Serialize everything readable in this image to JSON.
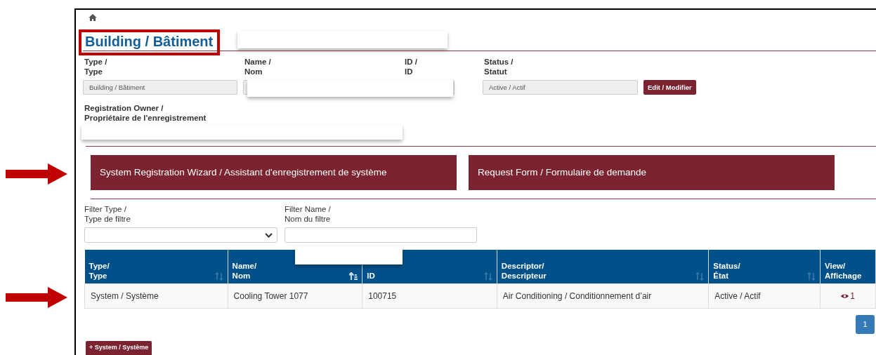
{
  "title": "Building / Bâtiment",
  "fields": [
    {
      "label_lines": [
        "Type /",
        "Type"
      ],
      "value": "Building / Bâtiment"
    },
    {
      "label_lines": [
        "Name /",
        "Nom"
      ]
    },
    {
      "label_lines": [
        "ID /",
        "ID"
      ]
    },
    {
      "label_lines": [
        "Status /",
        "Statut"
      ],
      "value": "Active / Actif"
    }
  ],
  "edit_button": "Edit / Modifier",
  "registration_owner": {
    "label_lines": [
      "Registration Owner /",
      "Propriétaire de l'enregistrement"
    ]
  },
  "action_buttons": [
    "System Registration Wizard / Assistant d'enregistrement de système",
    "Request Form / Formulaire de demande"
  ],
  "filters": [
    {
      "kind": "select",
      "label_lines": [
        "Filter Type /",
        "Type de filtre"
      ]
    },
    {
      "kind": "text",
      "label_lines": [
        "Filter Name /",
        "Nom du filtre"
      ]
    }
  ],
  "table": {
    "columns": [
      {
        "lines": [
          "Type/",
          "Type"
        ],
        "sortable": true,
        "sorted": false
      },
      {
        "lines": [
          "Name/",
          "Nom"
        ],
        "sortable": true,
        "sorted": true
      },
      {
        "lines": [
          "ID"
        ],
        "sortable": true,
        "sorted": false
      },
      {
        "lines": [
          "Descriptor/",
          "Descripteur"
        ],
        "sortable": true,
        "sorted": false
      },
      {
        "lines": [
          "Status/",
          "État"
        ],
        "sortable": true,
        "sorted": false
      },
      {
        "lines": [
          "View/",
          "Affichage"
        ],
        "sortable": false
      }
    ],
    "rows": [
      {
        "cells": [
          "System / Système",
          "Cooling Tower 1077",
          "100715",
          "Air Conditioning / Conditionnement d’air",
          "Active / Actif"
        ],
        "view_count": "1"
      }
    ]
  },
  "pagination": [
    {
      "label": "1",
      "selected": true
    }
  ],
  "add_button": "+ System / Système"
}
